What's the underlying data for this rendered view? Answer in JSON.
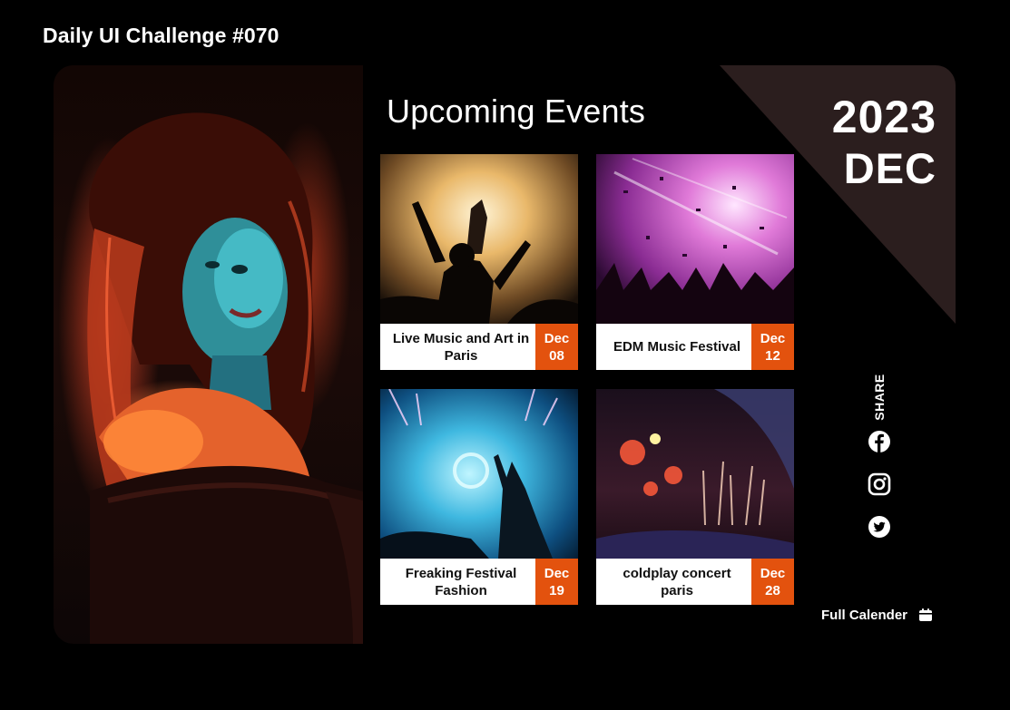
{
  "page_title": "Daily UI Challenge #070",
  "heading": "Upcoming Events",
  "calendar": {
    "year": "2023",
    "month": "DEC"
  },
  "events": [
    {
      "title": "Live Music and Art in Paris",
      "month": "Dec",
      "day": "08",
      "photo_icon": "concert-crowd-photo"
    },
    {
      "title": "EDM Music Festival",
      "month": "Dec",
      "day": "12",
      "photo_icon": "confetti-party-photo"
    },
    {
      "title": "Freaking Festival Fashion",
      "month": "Dec",
      "day": "19",
      "photo_icon": "festival-stage-photo"
    },
    {
      "title": "coldplay concert paris",
      "month": "Dec",
      "day": "28",
      "photo_icon": "stadium-fireworks-photo"
    }
  ],
  "share": {
    "label": "SHARE",
    "icons": [
      "facebook-icon",
      "instagram-icon",
      "twitter-icon"
    ]
  },
  "full_calendar_label": "Full Calender",
  "colors": {
    "accent": "#e3520e",
    "corner": "#2b1e1e",
    "background": "#000000"
  }
}
